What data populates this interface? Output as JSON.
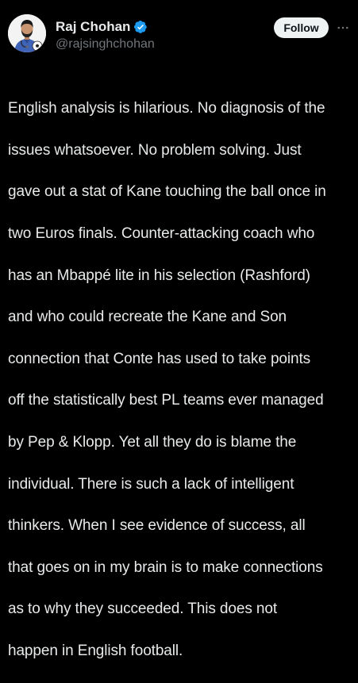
{
  "author": {
    "display_name": "Raj Chohan",
    "handle": "@rajsinghchohan",
    "verified": true,
    "verified_color": "#1d9bf0"
  },
  "actions": {
    "follow_label": "Follow",
    "more_icon": "more-horizontal-icon"
  },
  "tweet": {
    "lines": [
      "English analysis is hilarious. No diagnosis of the",
      "issues whatsoever. No problem solving. Just",
      "gave out a stat of Kane touching the ball once in",
      "two Euros finals. Counter-attacking coach who",
      "has an Mbappé lite in his selection (Rashford)",
      "and who could recreate the Kane and Son",
      "connection that Conte has used to take points",
      "off the statistically best PL teams ever managed",
      "by Pep & Klopp. Yet all they do is blame the",
      "individual. There is such a lack of intelligent",
      "thinkers. When I see evidence of success, all",
      "that goes on in my brain is to make connections",
      "as to why they succeeded. This does not",
      "happen in English football."
    ]
  },
  "colors": {
    "background": "#000000",
    "text_primary": "#e7e9ea",
    "text_secondary": "#71767b",
    "follow_button_bg": "#eff3f4",
    "follow_button_text": "#0f1419"
  }
}
